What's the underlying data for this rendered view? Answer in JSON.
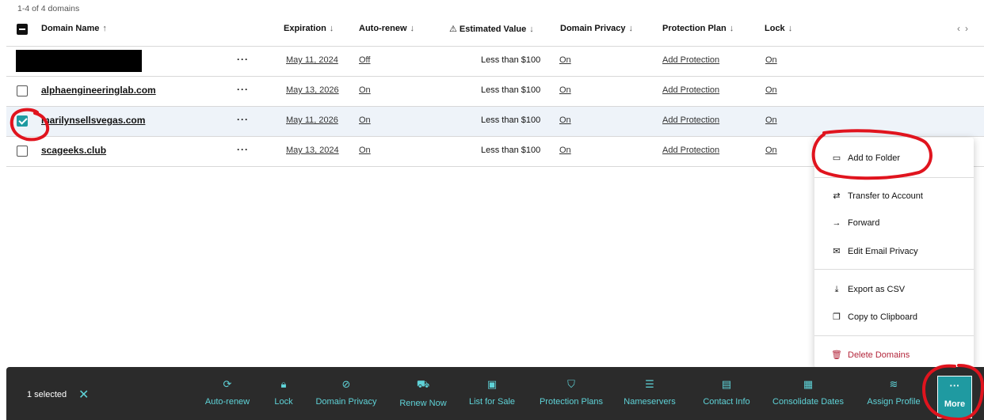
{
  "table": {
    "count_text": "1-4 of 4 domains",
    "columns": {
      "domain_name": "Domain Name",
      "expiration": "Expiration",
      "auto_renew": "Auto-renew",
      "estimated_value": "Estimated Value",
      "domain_privacy": "Domain Privacy",
      "protection_plan": "Protection Plan",
      "lock": "Lock"
    },
    "rows": [
      {
        "domain": "",
        "redacted": true,
        "expiration": "May 11, 2024",
        "auto_renew": "Off",
        "value": "Less than $100",
        "privacy": "On",
        "protection": "Add Protection",
        "lock": "On",
        "checked": false
      },
      {
        "domain": "alphaengineeringlab.com",
        "redacted": false,
        "expiration": "May 13, 2026",
        "auto_renew": "On",
        "value": "Less than $100",
        "privacy": "On",
        "protection": "Add Protection",
        "lock": "On",
        "checked": false
      },
      {
        "domain": "marilynsellsvegas.com",
        "redacted": false,
        "expiration": "May 11, 2026",
        "auto_renew": "On",
        "value": "Less than $100",
        "privacy": "On",
        "protection": "Add Protection",
        "lock": "On",
        "checked": true
      },
      {
        "domain": "scageeks.club",
        "redacted": false,
        "expiration": "May 13, 2024",
        "auto_renew": "On",
        "value": "Less than $100",
        "privacy": "On",
        "protection": "Add Protection",
        "lock": "On",
        "checked": false
      }
    ],
    "row_actions": "···"
  },
  "menu": {
    "add_to_folder": "Add to Folder",
    "transfer": "Transfer to Account",
    "forward": "Forward",
    "edit_email_privacy": "Edit Email Privacy",
    "export_csv": "Export as CSV",
    "copy_clipboard": "Copy to Clipboard",
    "delete_domains": "Delete Domains"
  },
  "bulk_bar": {
    "selected_text": "1 selected",
    "actions": {
      "auto_renew": "Auto-renew",
      "lock": "Lock",
      "domain_privacy": "Domain Privacy",
      "renew_now": "Renew Now",
      "list_for_sale": "List for Sale",
      "protection_plans": "Protection Plans",
      "nameservers": "Nameservers",
      "contact_info": "Contact Info",
      "consolidate_dates": "Consolidate Dates",
      "assign_profile": "Assign Profile",
      "more": "More"
    }
  },
  "colors": {
    "accent": "#1f9aa1",
    "bar_bg": "#2b2b2b",
    "annotation": "#e0141e",
    "danger": "#b3263b"
  }
}
